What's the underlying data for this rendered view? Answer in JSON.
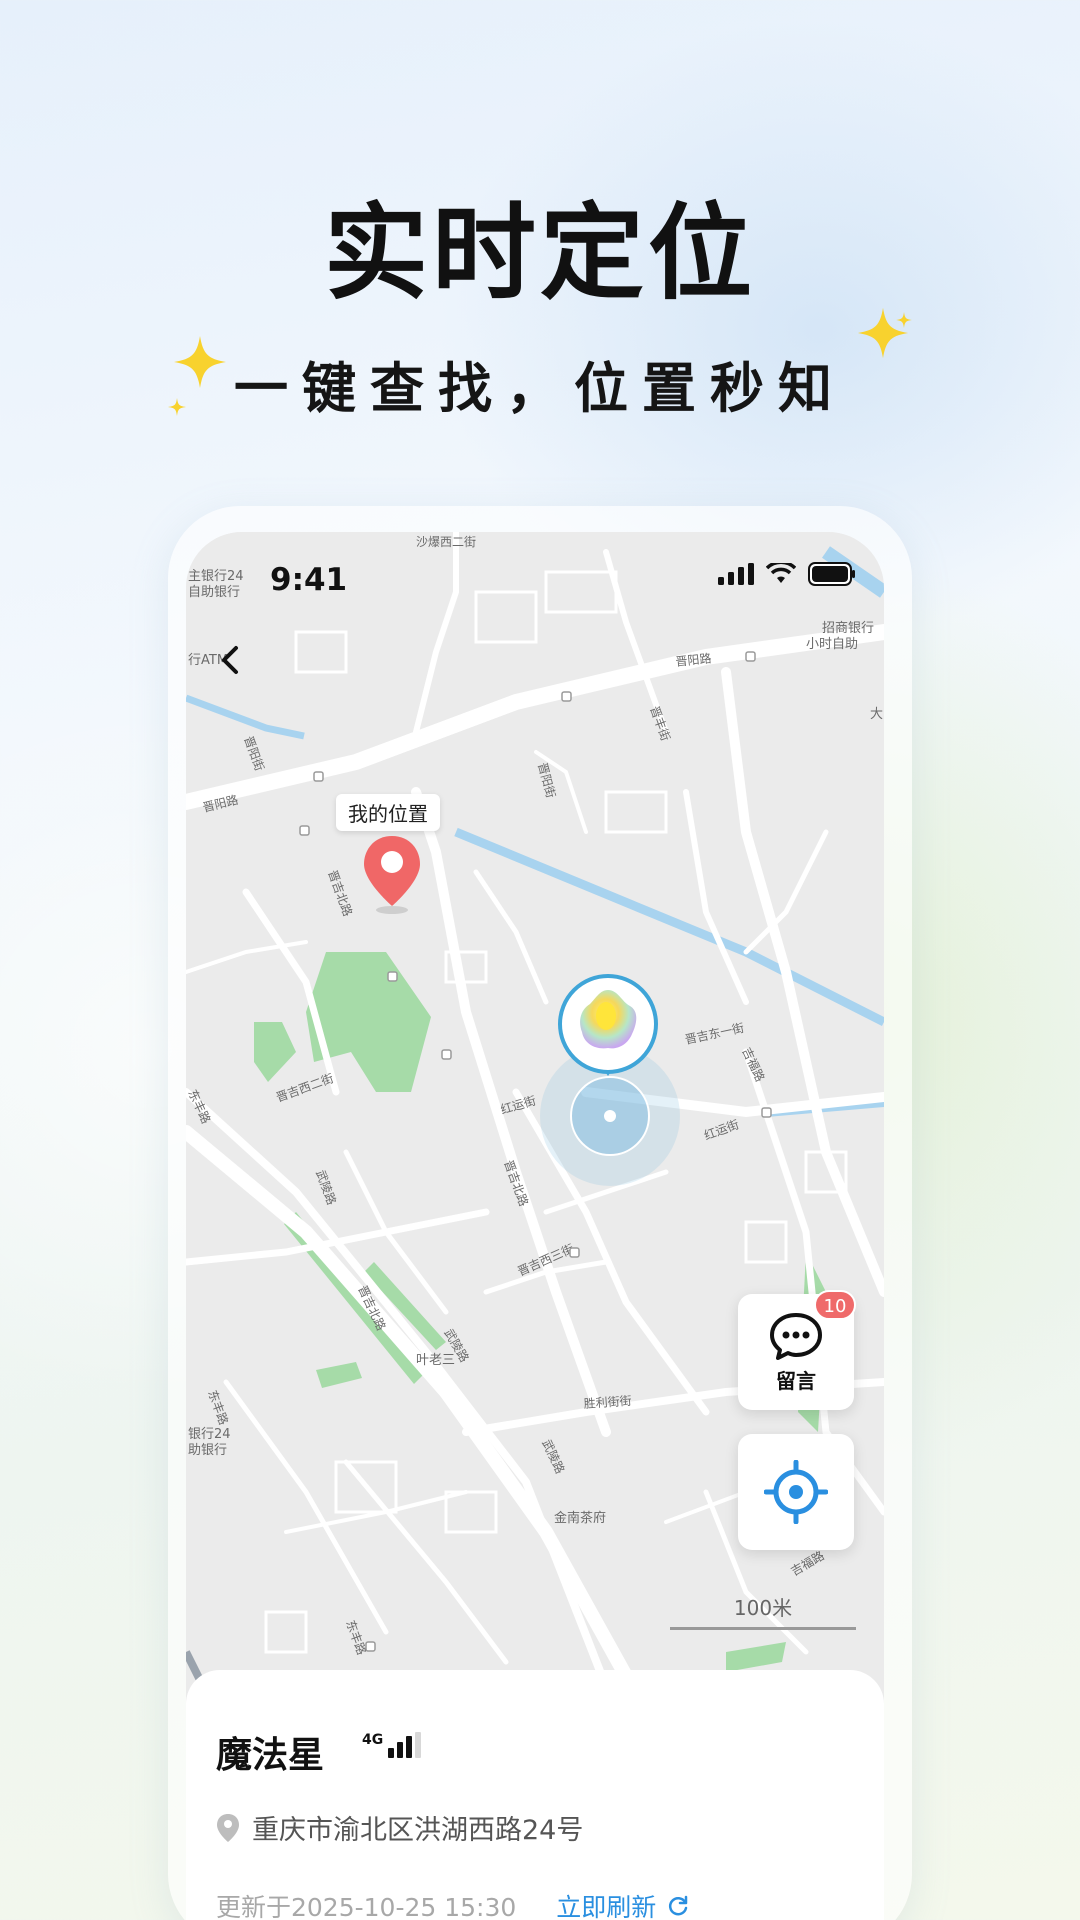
{
  "hero": {
    "title": "实时定位",
    "subtitle": "一键查找，位置秒知"
  },
  "status_bar": {
    "time": "9:41"
  },
  "map": {
    "my_location_label": "我的位置",
    "scale_text": "100米",
    "roads": [
      "沙爆西二街",
      "晋阳路",
      "晋阳路",
      "晋阳街",
      "晋阳街",
      "晋吉北路",
      "晋吉西二街",
      "晋吉东一街",
      "红运街",
      "红运街",
      "晋吉北路",
      "武陵路",
      "晋吉西三街",
      "晋吉北路",
      "武陵路",
      "胜利街街",
      "武陵路",
      "吉福路",
      "吉福路",
      "东丰路"
    ],
    "pois": [
      "主银行24 / 自助银行",
      "行ATM",
      "招商银行 / 小时自助",
      "大",
      "叶老三",
      "金南茶府",
      "银行24 / 助银行"
    ]
  },
  "fab": {
    "message_label": "留言",
    "message_badge": "10",
    "locate": "locate"
  },
  "device": {
    "name": "魔法星",
    "network": "4G",
    "address": "重庆市渝北区洪湖西路24号",
    "updated": "更新于2025-10-25 15:30",
    "refresh_label": "立即刷新"
  },
  "colors": {
    "accent": "#2a8fe0",
    "pin": "#f06767",
    "badge": "#ef6a6a",
    "park": "#a6dba8",
    "water": "#a8d3ef"
  },
  "icons": [
    "back-chevron-icon",
    "signal-icon",
    "wifi-icon",
    "battery-icon",
    "map-pin-icon",
    "chat-bubble-icon",
    "crosshair-icon",
    "location-pin-icon",
    "refresh-icon",
    "sparkle-icon"
  ]
}
